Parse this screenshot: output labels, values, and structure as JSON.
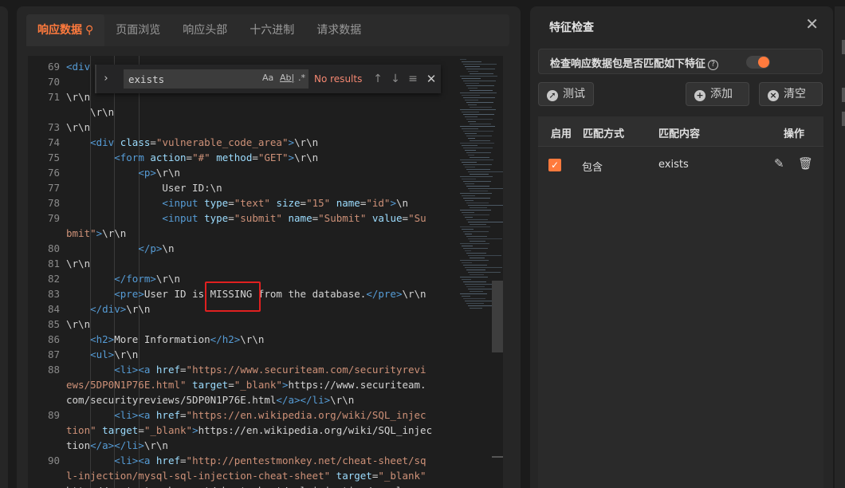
{
  "tabs": [
    {
      "label": "响应数据",
      "active": true
    },
    {
      "label": "页面浏览"
    },
    {
      "label": "响应头部"
    },
    {
      "label": "十六进制"
    },
    {
      "label": "请求数据"
    }
  ],
  "editor": {
    "lines": [
      {
        "num": "69",
        "html": "<span class='tg'>&lt;div</span>"
      },
      {
        "num": "70",
        "html": ""
      },
      {
        "num": "71",
        "html": "\\r\\n"
      },
      {
        "num": "",
        "html": "    \\r\\n"
      },
      {
        "num": "73",
        "html": "\\r\\n"
      },
      {
        "num": "74",
        "html": "    <span class='tg'>&lt;div</span> <span class='at'>class</span>=<span class='st'>\"vulnerable_code_area\"</span><span class='tg'>&gt;</span>\\r\\n"
      },
      {
        "num": "75",
        "html": "        <span class='tg'>&lt;form</span> <span class='at'>action</span>=<span class='st'>\"#\"</span> <span class='at'>method</span>=<span class='st'>\"GET\"</span><span class='tg'>&gt;</span>\\r\\n"
      },
      {
        "num": "76",
        "html": "            <span class='tg'>&lt;p&gt;</span>\\r\\n"
      },
      {
        "num": "77",
        "html": "                User ID:\\n"
      },
      {
        "num": "78",
        "html": "                <span class='tg'>&lt;input</span> <span class='at'>type</span>=<span class='st'>\"text\"</span> <span class='at'>size</span>=<span class='st'>\"15\"</span> <span class='at'>name</span>=<span class='st'>\"id\"</span><span class='tg'>&gt;</span>\\n"
      },
      {
        "num": "79",
        "html": "                <span class='tg'>&lt;input</span> <span class='at'>type</span>=<span class='st'>\"submit\"</span> <span class='at'>name</span>=<span class='st'>\"Submit\"</span> <span class='at'>value</span>=<span class='st'>\"Su</span>"
      },
      {
        "num": "",
        "html": "<span class='st'>bmit\"</span><span class='tg'>&gt;</span>\\r\\n"
      },
      {
        "num": "80",
        "html": "            <span class='tg'>&lt;/p&gt;</span>\\n"
      },
      {
        "num": "81",
        "html": "\\r\\n"
      },
      {
        "num": "82",
        "html": "        <span class='tg'>&lt;/form&gt;</span>\\r\\n"
      },
      {
        "num": "83",
        "html": "        <span class='tg'>&lt;pre&gt;</span>User ID is MISSING from the database.<span class='tg'>&lt;/pre&gt;</span>\\r\\n"
      },
      {
        "num": "84",
        "html": "    <span class='tg'>&lt;/div&gt;</span>\\r\\n"
      },
      {
        "num": "85",
        "html": "\\r\\n"
      },
      {
        "num": "86",
        "html": "    <span class='tg'>&lt;h2&gt;</span>More Information<span class='tg'>&lt;/h2&gt;</span>\\r\\n"
      },
      {
        "num": "87",
        "html": "    <span class='tg'>&lt;ul&gt;</span>\\r\\n"
      },
      {
        "num": "88",
        "html": "        <span class='tg'>&lt;li&gt;&lt;a</span> <span class='at'>href</span>=<span class='st'>\"https://www.securiteam.com/securityrevi</span>"
      },
      {
        "num": "",
        "html": "<span class='st'>ews/5DP0N1P76E.html\"</span> <span class='at'>target</span>=<span class='st'>\"_blank\"</span><span class='tg'>&gt;</span>https://www.securiteam."
      },
      {
        "num": "",
        "html": "com/securityreviews/5DP0N1P76E.html<span class='tg'>&lt;/a&gt;&lt;/li&gt;</span>\\r\\n"
      },
      {
        "num": "89",
        "html": "        <span class='tg'>&lt;li&gt;&lt;a</span> <span class='at'>href</span>=<span class='st'>\"https://en.wikipedia.org/wiki/SQL_injec</span>"
      },
      {
        "num": "",
        "html": "<span class='st'>tion\"</span> <span class='at'>target</span>=<span class='st'>\"_blank\"</span><span class='tg'>&gt;</span>https://en.wikipedia.org/wiki/SQL_injec"
      },
      {
        "num": "",
        "html": "tion<span class='tg'>&lt;/a&gt;&lt;/li&gt;</span>\\r\\n"
      },
      {
        "num": "90",
        "html": "        <span class='tg'>&lt;li&gt;&lt;a</span> <span class='at'>href</span>=<span class='st'>\"http://pentestmonkey.net/cheat-sheet/sq</span>"
      },
      {
        "num": "",
        "html": "<span class='st'>l-injection/mysql-sql-injection-cheat-sheet\"</span> <span class='at'>target</span>=<span class='st'>\"_blank\"</span>"
      },
      {
        "num": "",
        "html": "<span class='tx'>http://pentestmonkey.net/cheat-sheet/sql-injection/mysql</span>"
      }
    ]
  },
  "find": {
    "value": "exists",
    "case_label": "Aa",
    "word_label": "Ab|",
    "regex_label": ".*",
    "status": "No results"
  },
  "panel": {
    "title": "特征检查",
    "match_label": "检查响应数据包是否匹配如下特征",
    "buttons": {
      "test": "测试",
      "add": "添加",
      "clear": "清空"
    },
    "columns": {
      "enabled": "启用",
      "method": "匹配方式",
      "content": "匹配内容",
      "ops": "操作"
    },
    "rows": [
      {
        "enabled": true,
        "method": "包含",
        "content": "exists"
      }
    ]
  },
  "colors": {
    "accent": "#ff7a3d",
    "highlight": "#e02020"
  }
}
